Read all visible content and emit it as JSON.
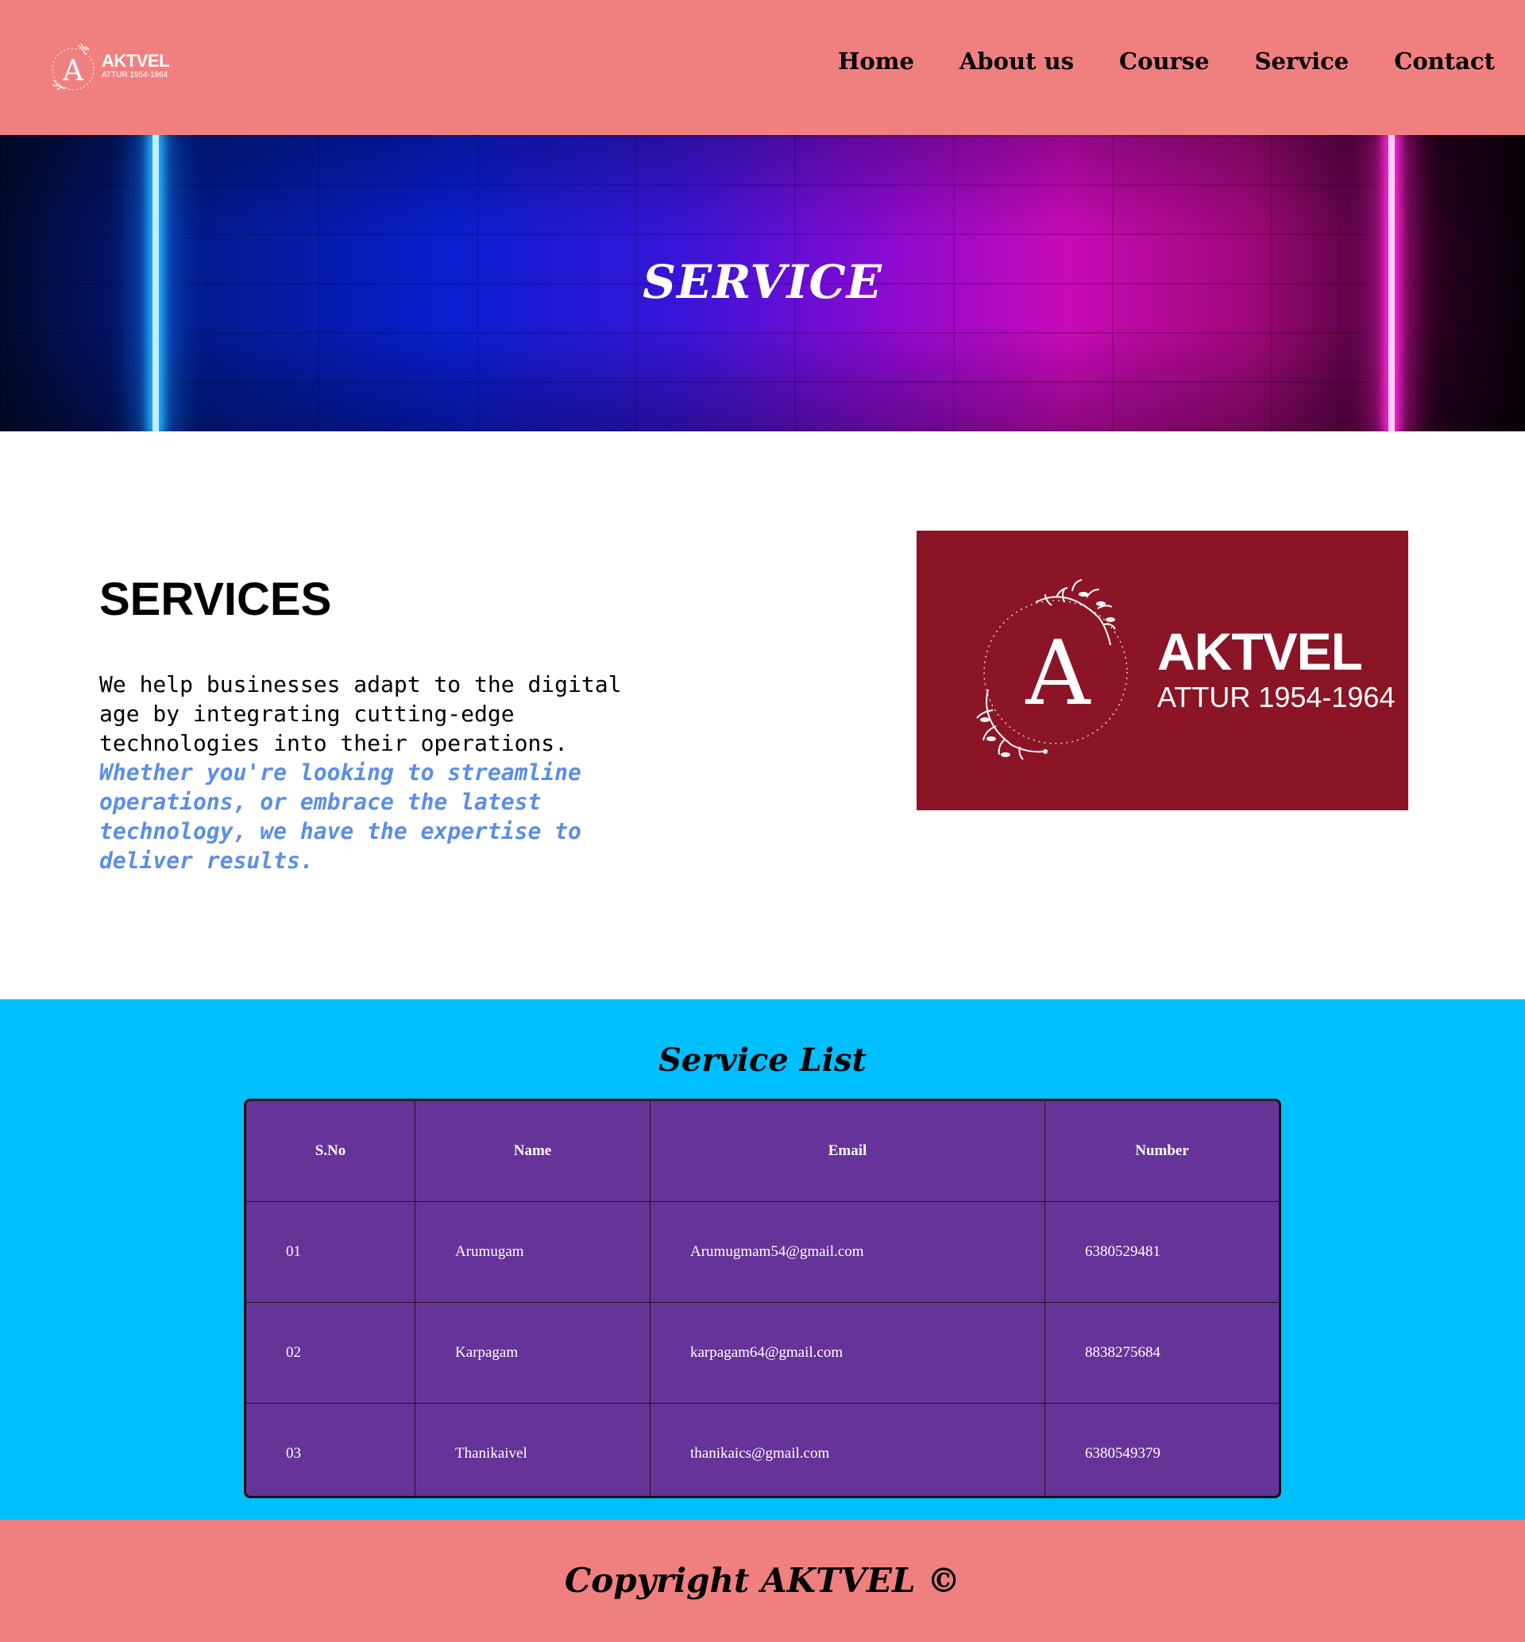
{
  "header": {
    "logo": {
      "name": "AKTVEL",
      "subtitle": "ATTUR 1954-1964",
      "letter": "A"
    },
    "nav": [
      "Home",
      "About us",
      "Course",
      "Service",
      "Contact"
    ]
  },
  "hero": {
    "title": "SERVICE"
  },
  "services": {
    "heading": "SERVICES",
    "text": "We help businesses adapt to the digital age by integrating cutting-edge technologies into their operations.",
    "highlight": "Whether you're looking to streamline operations, or embrace the latest technology, we have the expertise to deliver results."
  },
  "brand_card": {
    "letter": "A",
    "name": "AKTVEL",
    "subtitle": "ATTUR 1954-1964",
    "background": "#8b1526"
  },
  "service_list": {
    "title": "Service List",
    "columns": [
      "S.No",
      "Name",
      "Email",
      "Number"
    ],
    "rows": [
      [
        "01",
        "Arumugam",
        "Arumugmam54@gmail.com",
        "6380529481"
      ],
      [
        "02",
        "Karpagam",
        "karpagam64@gmail.com",
        "8838275684"
      ],
      [
        "03",
        "Thanikaivel",
        "thanikaics@gmail.com",
        "6380549379"
      ]
    ]
  },
  "footer": {
    "text": "Copyright AKTVEL ©"
  },
  "colors": {
    "header_bg": "#f08080",
    "list_bg": "#00bfff",
    "table_bg": "#663399",
    "highlight_text": "#5b8ee6"
  }
}
